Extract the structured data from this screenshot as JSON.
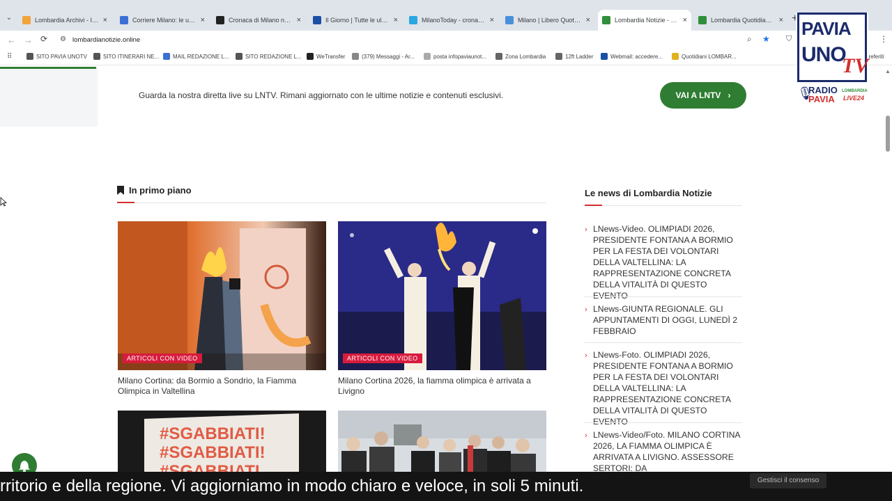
{
  "browser": {
    "tabs": [
      {
        "title": "Lombardia Archivi - Italpr",
        "color": "#f2a33c",
        "active": false
      },
      {
        "title": "Corriere Milano: le ultime",
        "color": "#3b6fd4",
        "active": false
      },
      {
        "title": "Cronaca di Milano notizie",
        "color": "#222222",
        "active": false
      },
      {
        "title": "Il Giorno | Tutte le ultime",
        "color": "#1a4fa3",
        "active": false
      },
      {
        "title": "MilanoToday - cronaca e",
        "color": "#2aa8e0",
        "active": false
      },
      {
        "title": "Milano | Libero Quotidian",
        "color": "#4a90d9",
        "active": false
      },
      {
        "title": "Lombardia Notizie - Lom",
        "color": "#2f8f3a",
        "active": true
      },
      {
        "title": "Lombardia Quotidiano - ",
        "color": "#2f8f3a",
        "active": false
      }
    ],
    "url": "lombardianotizie.online",
    "bookmarks": [
      {
        "label": "SITO PAVIA UNOTV"
      },
      {
        "label": "SITO ITINERARI NE..."
      },
      {
        "label": "MAIL REDAZIONE L..."
      },
      {
        "label": "SITO REDAZIONE L..."
      },
      {
        "label": "WeTransfer"
      },
      {
        "label": "(379) Messaggi - Ar..."
      },
      {
        "label": "posta infopaviaunot..."
      },
      {
        "label": "Zona Lombardia"
      },
      {
        "label": "12ft Ladder"
      },
      {
        "label": "Webmail: accedere..."
      },
      {
        "label": "Quotidiani LOMBAR..."
      }
    ],
    "bookmarks_overflow": "preferiti"
  },
  "live_banner": {
    "text": "Guarda la nostra diretta live su LNTV. Rimani aggiornato con le ultime notizie e contenuti esclusivi.",
    "cta": "VAI A LNTV",
    "cta_color": "#2f7d32"
  },
  "main": {
    "section_title": "In primo piano",
    "cards": [
      {
        "badge": "ARTICOLI CON VIDEO",
        "title": "Milano Cortina: da Bormio a Sondrio, la Fiamma Olimpica in Valtellina"
      },
      {
        "badge": "ARTICOLI CON VIDEO",
        "title": "Milano Cortina 2026, la fiamma olimpica è arrivata a Livigno"
      },
      {
        "sign_text": "#SGABBIATI!\n#SGABBIATI!\n#SGABBIATI"
      },
      {}
    ]
  },
  "sidebar": {
    "title": "Le news di Lombardia Notizie",
    "items": [
      "LNews-Video. OLIMPIADI 2026, PRESIDENTE FONTANA A BORMIO PER LA FESTA DEI VOLONTARI DELLA VALTELLINA: LA RAPPRESENTAZIONE CONCRETA DELLA VITALITÀ DI QUESTO EVENTO",
      "LNews-GIUNTA REGIONALE. GLI APPUNTAMENTI DI OGGI, LUNEDÌ 2 FEBBRAIO",
      "LNews-Foto. OLIMPIADI 2026, PRESIDENTE FONTANA A BORMIO PER LA FESTA DEI VOLONTARI DELLA VALTELLINA: LA RAPPRESENTAZIONE CONCRETA DELLA VITALITÀ DI QUESTO EVENTO",
      "LNews-Video/Foto. MILANO CORTINA 2026, LA FIAMMA OLIMPICA È ARRIVATA A LIVIGNO. ASSESSORE SERTORI: DA"
    ]
  },
  "cookie_button": "Gestisci il consenso",
  "subtitle": "rritorio e della regione. Vi aggiorniamo in modo chiaro e veloce, in soli 5 minuti.",
  "logo": {
    "line1": "PAVIA",
    "line2": "UNO",
    "tv": "TV",
    "radio": "RADIO",
    "radio2": "PAVIA",
    "lombardia": "LOMBARDIA",
    "live": "LIVE24"
  }
}
